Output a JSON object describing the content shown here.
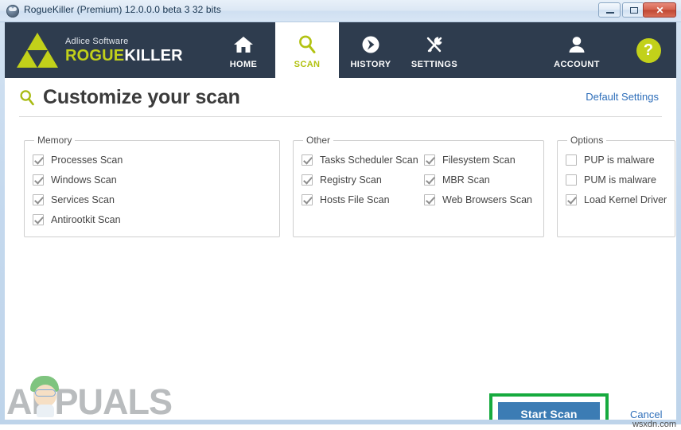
{
  "window": {
    "title": "RogueKiller (Premium) 12.0.0.0 beta 3 32 bits",
    "app_icon": "roguekiller-app-icon",
    "controls": {
      "minimize": "–",
      "maximize": "□",
      "close": "✕"
    }
  },
  "brand": {
    "subtitle": "Adlice Software",
    "name_part1": "ROGUE",
    "name_part2": "KILLER",
    "logo_icon": "triangle-logo-icon"
  },
  "nav": {
    "items": [
      {
        "label": "HOME",
        "icon": "home-icon",
        "active": false
      },
      {
        "label": "SCAN",
        "icon": "search-icon",
        "active": true
      },
      {
        "label": "HISTORY",
        "icon": "history-arrow-icon",
        "active": false
      },
      {
        "label": "SETTINGS",
        "icon": "tools-icon",
        "active": false
      },
      {
        "label": "ACCOUNT",
        "icon": "user-icon",
        "active": false
      }
    ],
    "help_label": "?",
    "help_icon": "help-circle-icon"
  },
  "page": {
    "title": "Customize your scan",
    "title_icon": "search-icon",
    "default_settings_link": "Default Settings"
  },
  "groups": [
    {
      "key": "memory",
      "legend": "Memory",
      "columns": [
        {
          "items": [
            {
              "label": "Processes Scan",
              "checked": true
            },
            {
              "label": "Windows Scan",
              "checked": true
            },
            {
              "label": "Services Scan",
              "checked": true
            },
            {
              "label": "Antirootkit Scan",
              "checked": true
            }
          ]
        }
      ]
    },
    {
      "key": "other",
      "legend": "Other",
      "columns": [
        {
          "items": [
            {
              "label": "Tasks Scheduler Scan",
              "checked": true
            },
            {
              "label": "Registry Scan",
              "checked": true
            },
            {
              "label": "Hosts File Scan",
              "checked": true
            }
          ]
        },
        {
          "items": [
            {
              "label": "Filesystem Scan",
              "checked": true
            },
            {
              "label": "MBR Scan",
              "checked": true
            },
            {
              "label": "Web Browsers Scan",
              "checked": true
            }
          ]
        }
      ]
    },
    {
      "key": "options",
      "legend": "Options",
      "columns": [
        {
          "items": [
            {
              "label": "PUP is malware",
              "checked": false
            },
            {
              "label": "PUM is malware",
              "checked": false
            },
            {
              "label": "Load Kernel Driver",
              "checked": true
            }
          ]
        }
      ]
    }
  ],
  "footer": {
    "start_scan_label": "Start Scan",
    "cancel_label": "Cancel",
    "highlight_color": "#16aa3e",
    "button_color": "#3c7cb4"
  },
  "watermarks": {
    "appuals": "APPUALS",
    "source": "wsxdn.com"
  },
  "colors": {
    "nav_background": "#2e3c4e",
    "accent_green": "#c2d11a",
    "link_blue": "#2f6fba"
  }
}
